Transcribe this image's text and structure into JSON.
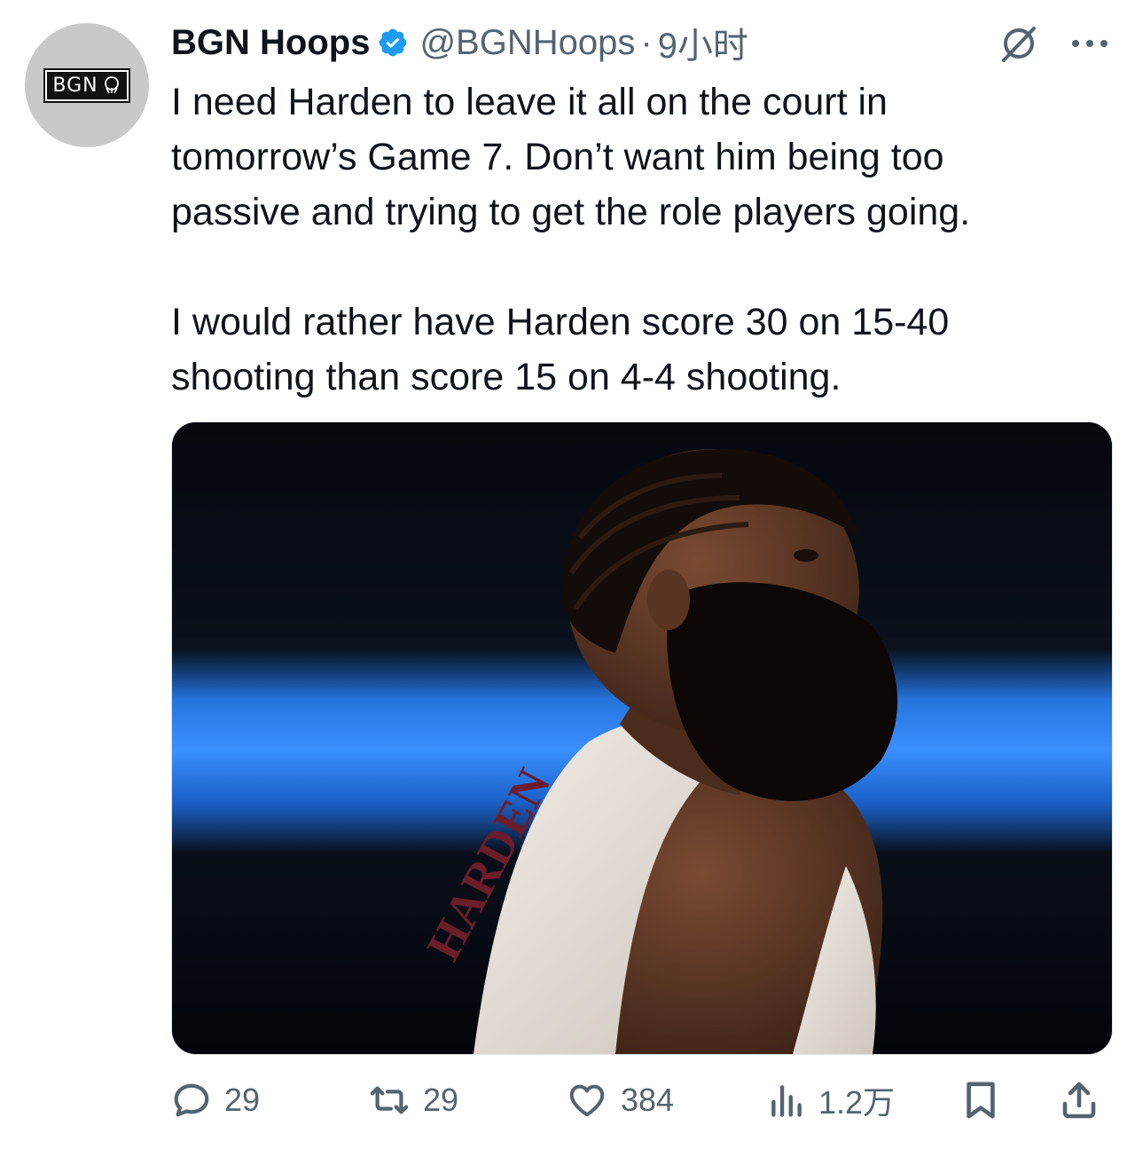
{
  "author": {
    "avatar_text": "BGN",
    "display_name": "BGN Hoops",
    "handle": "@BGNHoops",
    "separator": "·",
    "time": "9小时"
  },
  "tweet": {
    "text": "I need Harden to leave it all on the court in\ntomorrow’s Game 7. Don’t want him being too\npassive and trying to get the role players going.\n\nI would rather have Harden score 30 on 15-40\nshooting than score 15 on 4-4 shooting.",
    "media_jersey_text": "HARDEN"
  },
  "actions": {
    "replies": "29",
    "retweets": "29",
    "likes": "384",
    "views": "1.2万"
  },
  "colors": {
    "verified": "#1d9bf0",
    "muted": "#536471",
    "text": "#0f1419",
    "arena_blue": "#1e7bff"
  },
  "icons": [
    "grok-icon",
    "more-icon",
    "reply-icon",
    "retweet-icon",
    "like-icon",
    "views-icon",
    "bookmark-icon",
    "share-icon",
    "verified-icon"
  ]
}
